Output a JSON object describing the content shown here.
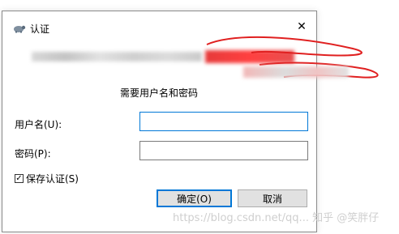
{
  "window": {
    "title": "认证",
    "close_glyph": "✕"
  },
  "dialog": {
    "prompt": "需要用户名和密码",
    "username_label": "用户名(U):",
    "username_value": "",
    "password_label": "密码(P):",
    "password_value": "",
    "remember_label": "保存认证(S)",
    "remember_checked": true,
    "ok_label": "确定(O)",
    "cancel_label": "取消"
  },
  "watermark": "https://blog.csdn.net/qq... 知乎 @笑胖仔",
  "colors": {
    "focus_border": "#0078d7",
    "button_bg": "#e1e1e1",
    "redaction_red": "#e02020"
  },
  "icons": [
    "tortoise-icon",
    "close-icon",
    "checkmark-icon"
  ]
}
